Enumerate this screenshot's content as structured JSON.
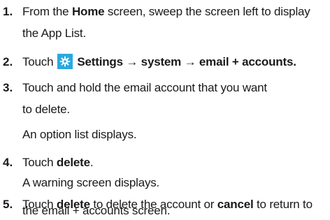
{
  "steps": [
    {
      "number": "1.",
      "line1": {
        "pre": "From the ",
        "bold": "Home",
        "post": " screen, sweep the screen left to display"
      },
      "line2": "the App List."
    },
    {
      "number": "2.",
      "pre": "Touch",
      "icon": "settings-gear-icon",
      "bold": "Settings → system → email + accounts."
    },
    {
      "number": "3.",
      "line1": "Touch and hold the email account that you want",
      "line2": "to delete.",
      "result": "An option list displays."
    },
    {
      "number": "4.",
      "pre": "Touch ",
      "bold": "delete",
      "post": ".",
      "result": "A warning screen displays."
    },
    {
      "number": "5.",
      "line1": {
        "pre": "Touch ",
        "bold1": "delete",
        "mid": " to delete the account or ",
        "bold2": "cancel",
        "post": " to return to"
      },
      "line2": "the email + accounts screen."
    }
  ],
  "colors": {
    "icon_bg": "#29a9e0",
    "text": "#1a1a1a"
  }
}
